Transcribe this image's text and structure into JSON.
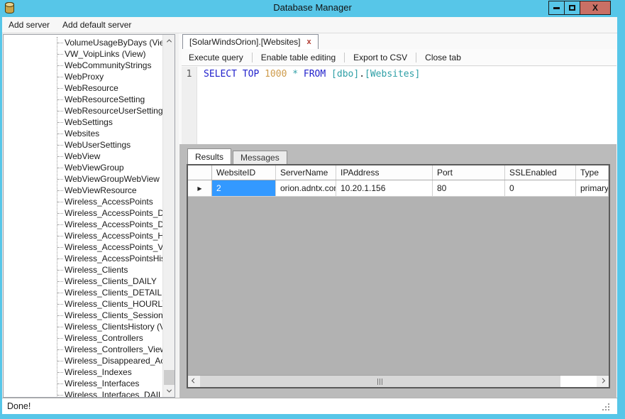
{
  "window": {
    "title": "Database Manager",
    "icon": "database-cylinder",
    "close_glyph": "X"
  },
  "menu": {
    "items": [
      "Add server",
      "Add default server"
    ]
  },
  "tree": {
    "items": [
      "VolumeUsageByDays (View)",
      "VW_VoipLinks (View)",
      "WebCommunityStrings",
      "WebProxy",
      "WebResource",
      "WebResourceSetting",
      "WebResourceUserSetting",
      "WebSettings",
      "Websites",
      "WebUserSettings",
      "WebView",
      "WebViewGroup",
      "WebViewGroupWebView",
      "WebViewResource",
      "Wireless_AccessPoints",
      "Wireless_AccessPoints_DAILY",
      "Wireless_AccessPoints_DETAIL",
      "Wireless_AccessPoints_HOURLY",
      "Wireless_AccessPoints_View (View)",
      "Wireless_AccessPointsHistory (View)",
      "Wireless_Clients",
      "Wireless_Clients_DAILY",
      "Wireless_Clients_DETAIL",
      "Wireless_Clients_HOURLY",
      "Wireless_Clients_SessionHistory",
      "Wireless_ClientsHistory (View)",
      "Wireless_Controllers",
      "Wireless_Controllers_View (View)",
      "Wireless_Disappeared_AccessPoints",
      "Wireless_Indexes",
      "Wireless_Interfaces",
      "Wireless_Interfaces_DAILY"
    ]
  },
  "doc_tab": {
    "label": "[SolarWindsOrion].[Websites]",
    "close_label": "x"
  },
  "toolbar": {
    "items": [
      "Execute query",
      "Enable table editing",
      "Export to CSV",
      "Close tab"
    ]
  },
  "editor": {
    "line_number": "1",
    "sql_text": "SELECT TOP 1000 * FROM [dbo].[Websites]",
    "tokens": [
      {
        "text": "SELECT",
        "type": "kw"
      },
      {
        "text": " ",
        "type": "pl"
      },
      {
        "text": "TOP",
        "type": "kw"
      },
      {
        "text": " ",
        "type": "pl"
      },
      {
        "text": "1000",
        "type": "num"
      },
      {
        "text": " ",
        "type": "pl"
      },
      {
        "text": "*",
        "type": "op"
      },
      {
        "text": " ",
        "type": "pl"
      },
      {
        "text": "FROM",
        "type": "kw"
      },
      {
        "text": " ",
        "type": "pl"
      },
      {
        "text": "[dbo]",
        "type": "id"
      },
      {
        "text": ".",
        "type": "pl"
      },
      {
        "text": "[Websites]",
        "type": "id"
      }
    ]
  },
  "results": {
    "tabs": [
      "Results",
      "Messages"
    ],
    "active_tab": "Results"
  },
  "grid": {
    "columns": [
      "WebsiteID",
      "ServerName",
      "IPAddress",
      "Port",
      "SSLEnabled",
      "Type"
    ],
    "rows": [
      [
        "2",
        "orion.adntx.com",
        "10.20.1.156",
        "80",
        "0",
        "primary"
      ]
    ],
    "selected_cell": {
      "row": 0,
      "col": 0
    }
  },
  "statusbar": {
    "text": "Done!"
  },
  "colors": {
    "titlebar": "#57c6e8",
    "close_button": "#c97065",
    "selection_blue": "#3399ff",
    "sql_keyword": "#2222cc",
    "sql_number": "#ce9b4b",
    "sql_identifier": "#2e9fa6",
    "results_band": "#bbbbbb"
  }
}
